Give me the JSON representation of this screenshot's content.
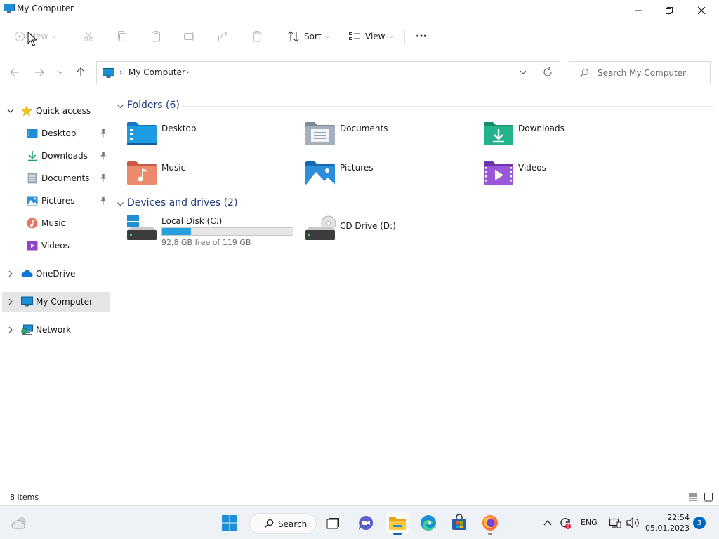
{
  "window": {
    "title": "My Computer"
  },
  "toolbar": {
    "new_label": "New",
    "sort_label": "Sort",
    "view_label": "View",
    "more_label": "···"
  },
  "address": {
    "crumb": "My Computer"
  },
  "search": {
    "placeholder": "Search My Computer"
  },
  "sidebar": {
    "quick_access": "Quick access",
    "items": [
      {
        "label": "Desktop",
        "icon": "desktop-icon",
        "pinned": true
      },
      {
        "label": "Downloads",
        "icon": "downloads-icon",
        "pinned": true
      },
      {
        "label": "Documents",
        "icon": "documents-icon",
        "pinned": true
      },
      {
        "label": "Pictures",
        "icon": "pictures-icon",
        "pinned": true
      },
      {
        "label": "Music",
        "icon": "music-icon",
        "pinned": false
      },
      {
        "label": "Videos",
        "icon": "videos-icon",
        "pinned": false
      }
    ],
    "onedrive": "OneDrive",
    "my_computer": "My Computer",
    "network": "Network"
  },
  "folders": {
    "heading": "Folders (6)",
    "items": [
      {
        "label": "Desktop"
      },
      {
        "label": "Documents"
      },
      {
        "label": "Downloads"
      },
      {
        "label": "Music"
      },
      {
        "label": "Pictures"
      },
      {
        "label": "Videos"
      }
    ]
  },
  "drives": {
    "heading": "Devices and drives (2)",
    "items": [
      {
        "label": "Local Disk (C:)",
        "free_text": "92,8 GB free of 119 GB",
        "used_fraction": 0.22
      },
      {
        "label": "CD Drive (D:)"
      }
    ]
  },
  "status": {
    "count": "8 items"
  },
  "taskbar": {
    "search_label": "Search",
    "language": "ENG",
    "time": "22:54",
    "date": "05.01.2023",
    "notifications": "3"
  },
  "colors": {
    "accent": "#0067c0",
    "drive_bar": "#26a0da",
    "heading": "#1f3a7a"
  }
}
